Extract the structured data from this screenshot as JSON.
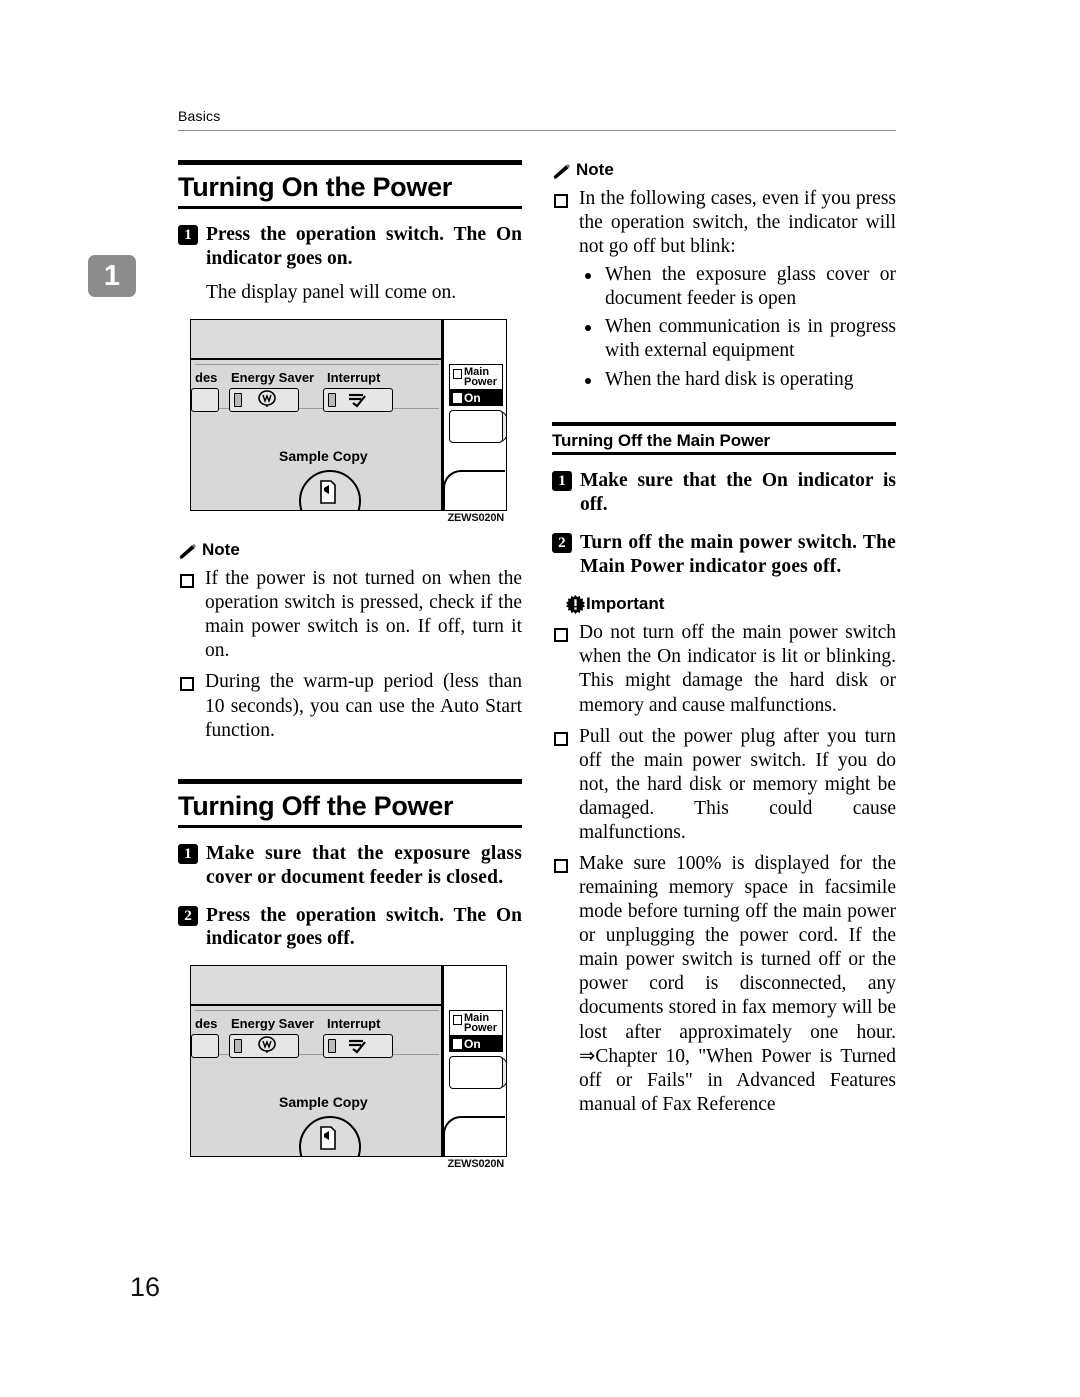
{
  "page": {
    "running_head": "Basics",
    "folio": "16"
  },
  "chapter_tab": {
    "number": "1"
  },
  "left_column": {
    "section1": {
      "heading": "Turning On the Power",
      "steps": [
        {
          "num": "1",
          "text": "Press the operation switch. The On indicator goes on."
        }
      ],
      "body": "The display panel will come on.",
      "figure": {
        "caption": "ZEWS020N",
        "labels": {
          "modes_truncated": "des",
          "energy_saver": "Energy Saver",
          "interrupt": "Interrupt",
          "main_power": "Main\nPower",
          "main_power_line1": "Main",
          "main_power_line2": "Power",
          "on": "On",
          "sample_copy": "Sample Copy"
        }
      },
      "note": {
        "label": "Note",
        "items": [
          "If the power is not turned on when the operation switch is pressed, check if the main power switch is on. If off, turn it on.",
          "During the warm-up period (less than 10 seconds), you can use the Auto Start function."
        ]
      }
    },
    "section2": {
      "heading": "Turning Off the Power",
      "steps": [
        {
          "num": "1",
          "text": "Make sure that the exposure glass cover or document feeder is closed."
        },
        {
          "num": "2",
          "text": "Press the operation switch. The On indicator goes off."
        }
      ],
      "figure": {
        "caption": "ZEWS020N",
        "labels": {
          "modes_truncated": "des",
          "energy_saver": "Energy Saver",
          "interrupt": "Interrupt",
          "main_power_line1": "Main",
          "main_power_line2": "Power",
          "on": "On",
          "sample_copy": "Sample Copy"
        }
      }
    }
  },
  "right_column": {
    "note": {
      "label": "Note",
      "intro": "In the following cases, even if you press the operation switch, the indicator will not go off but blink:",
      "bullets": [
        "When the exposure glass cover or document feeder is open",
        "When communication is in progress with external equipment",
        "When the hard disk is operating"
      ]
    },
    "section3": {
      "heading": "Turning Off the Main Power",
      "steps": [
        {
          "num": "1",
          "text": "Make sure that the On indicator is off."
        },
        {
          "num": "2",
          "text": "Turn off the main power switch. The Main Power indicator goes off."
        }
      ],
      "important": {
        "label": "Important",
        "items": [
          "Do not turn off the main power switch when the On indicator is lit or blinking. This might damage the hard disk or memory and cause malfunctions.",
          "Pull out the power plug after you turn off the main power switch. If you do not, the hard disk or memory might be damaged. This could cause malfunctions.",
          "Make sure 100% is displayed for the remaining memory space in facsimile mode before turning off the main power or unplugging the power cord. If the main power switch is turned off or the power cord is disconnected, any documents stored in fax memory will be lost after approximately one hour. ⇒Chapter 10, \"When Power is Turned off or Fails\" in Advanced Features manual of Fax Reference"
        ]
      }
    }
  }
}
